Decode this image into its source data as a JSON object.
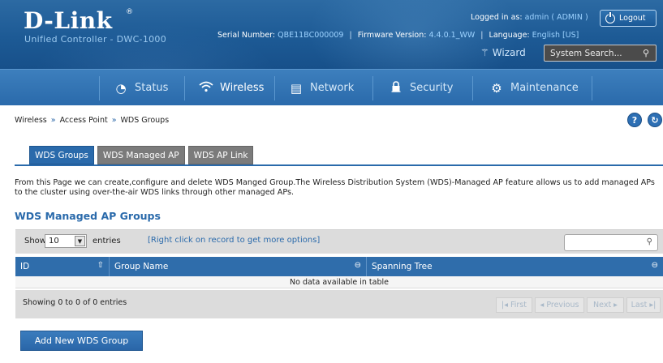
{
  "header": {
    "logo": "D-Link",
    "logo_mark": "®",
    "subtitle": "Unified Controller - DWC-1000",
    "serial_label": "Serial Number:",
    "serial_value": "QBE11BC000009",
    "firmware_label": "Firmware Version:",
    "firmware_value": "4.4.0.1_WW",
    "language_label": "Language:",
    "language_value": "English [US]",
    "logged_label": "Logged in as:",
    "logged_value": "admin ( ADMIN )",
    "logout_label": "Logout",
    "wizard_label": "Wizard",
    "system_search_placeholder": "System Search..."
  },
  "nav": {
    "items": [
      {
        "label": "Status",
        "icon": "status-icon"
      },
      {
        "label": "Wireless",
        "icon": "wifi-icon",
        "active": true
      },
      {
        "label": "Network",
        "icon": "network-icon"
      },
      {
        "label": "Security",
        "icon": "lock-icon"
      },
      {
        "label": "Maintenance",
        "icon": "gears-icon"
      }
    ]
  },
  "breadcrumb": {
    "items": [
      "Wireless",
      "Access Point",
      "WDS Groups"
    ],
    "separator": "»"
  },
  "help_icons": [
    "?",
    "↻"
  ],
  "tabs": [
    {
      "label": "WDS Groups",
      "active": true
    },
    {
      "label": "WDS Managed AP",
      "active": false
    },
    {
      "label": "WDS AP Link",
      "active": false
    }
  ],
  "description": "From this Page we can create,configure and delete WDS Manged Group.The Wireless Distribution System (WDS)-Managed AP feature allows us to add managed APs to the cluster using over-the-air WDS links through other managed APs.",
  "section_title": "WDS Managed AP Groups",
  "table": {
    "show_label": "Show",
    "show_value": "10",
    "entries_label": "entries",
    "right_click_hint": "[Right click on record to get more options]",
    "columns": [
      "ID",
      "Group Name",
      "Spanning Tree"
    ],
    "empty_text": "No data available in table",
    "info_text": "Showing 0 to 0 of 0 entries",
    "pager": {
      "first": "First",
      "previous": "Previous",
      "next": "Next",
      "last": "Last"
    }
  },
  "add_button_label": "Add New WDS Group",
  "colors": {
    "accent": "#2a6aab",
    "header_bg": "#1d5a95"
  }
}
